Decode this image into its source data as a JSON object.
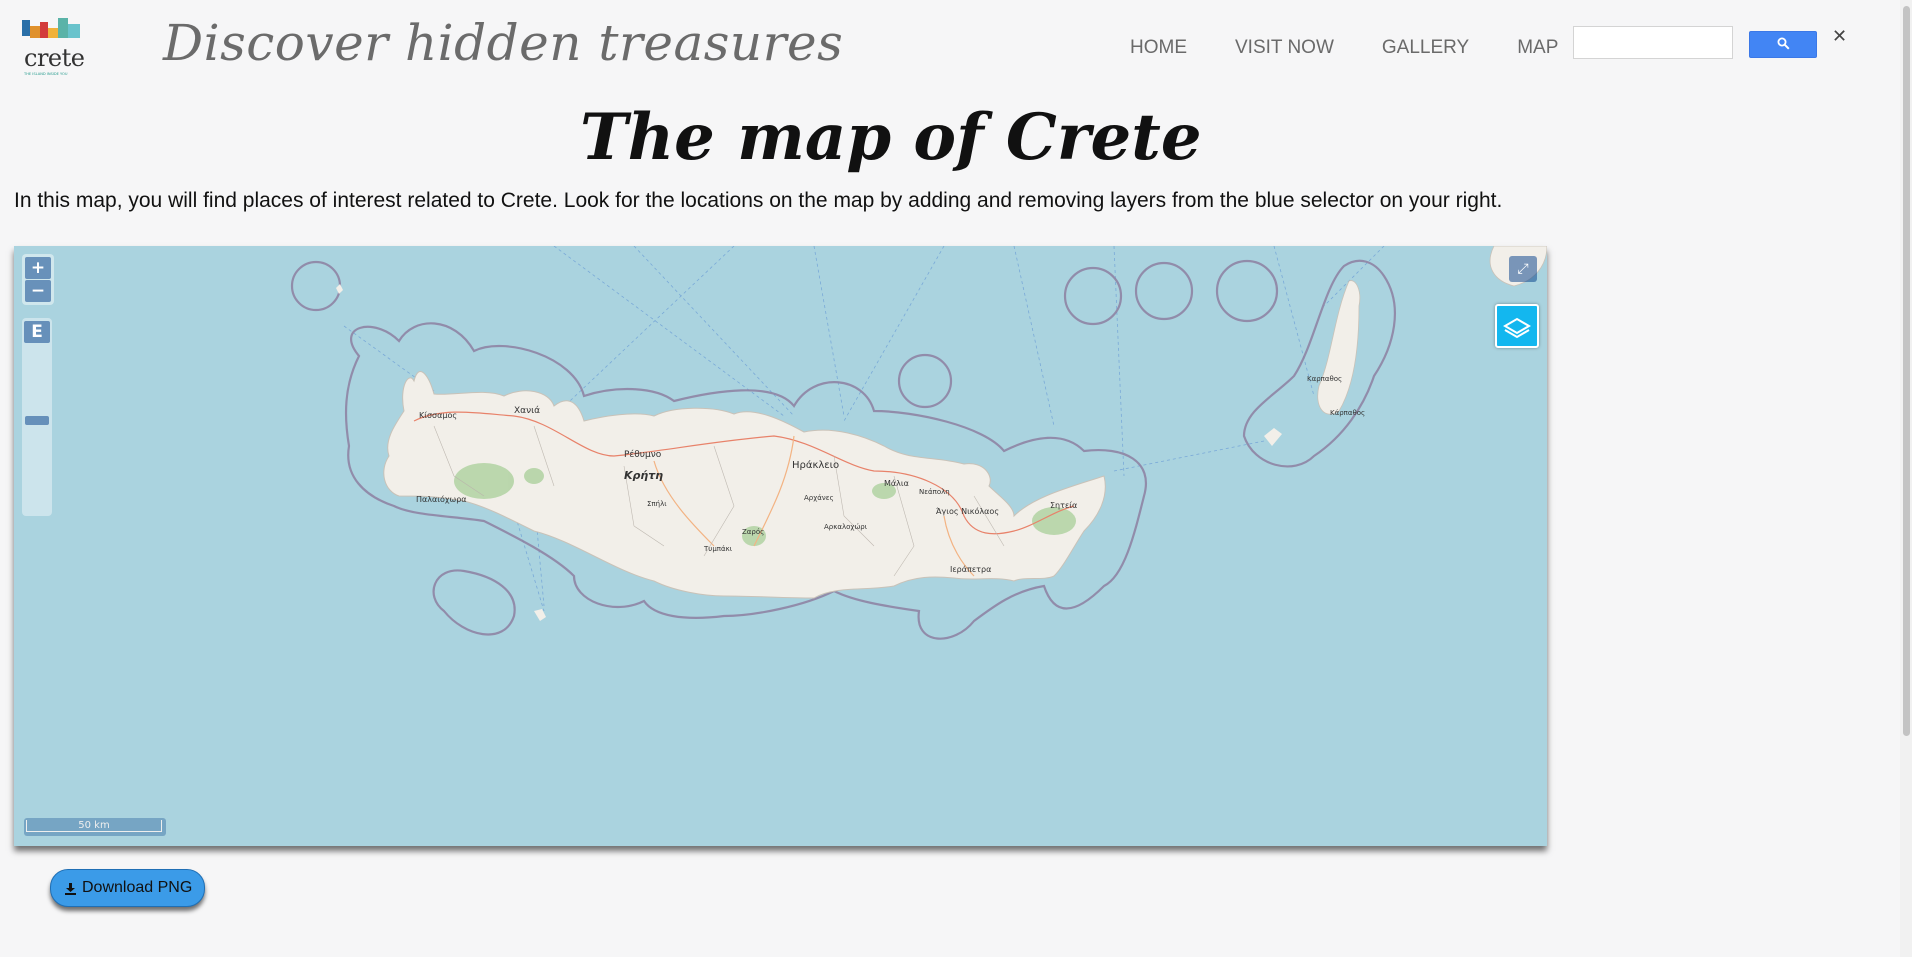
{
  "header": {
    "logo_text": "crete",
    "logo_subtext": "THE ISLAND INSIDE YOU",
    "tagline": "Discover hidden treasures"
  },
  "nav": [
    {
      "label": "HOME"
    },
    {
      "label": "VISIT NOW"
    },
    {
      "label": "GALLERY"
    },
    {
      "label": "MAP"
    }
  ],
  "search": {
    "placeholder": "",
    "button_icon": "search-icon",
    "clear_label": "✕"
  },
  "main": {
    "title": "The map of Crete",
    "intro": "In this map, you will find places of interest related to Crete. Look for the locations on the map by adding and removing layers from the blue selector on your right."
  },
  "map": {
    "zoom_in": "+",
    "zoom_out": "−",
    "extent_label": "E",
    "fullscreen_label": "⤢",
    "zoom_level_fraction": 0.55,
    "scale_label": "50 km",
    "colors": {
      "sea": "#aad3df",
      "land": "#f2efe9",
      "border": "#8d7fa1"
    },
    "place_labels": [
      {
        "text": "Κρήτη"
      },
      {
        "text": "Χανιά"
      },
      {
        "text": "Κίσσαμος"
      },
      {
        "text": "Ρέθυμνο"
      },
      {
        "text": "Ηράκλειο"
      },
      {
        "text": "Μάλια"
      },
      {
        "text": "Νεάπολη"
      },
      {
        "text": "Άγιος Νικόλαος"
      },
      {
        "text": "Σητεία"
      },
      {
        "text": "Ιεράπετρα"
      },
      {
        "text": "Αρχάνες"
      },
      {
        "text": "Αρκαλοχώρι"
      },
      {
        "text": "Ζαρός"
      },
      {
        "text": "Τυμπάκι"
      },
      {
        "text": "Σπήλι"
      },
      {
        "text": "Παλαιόχωρα"
      },
      {
        "text": "Καρπαθος"
      },
      {
        "text": "Κάρπαθος"
      }
    ]
  },
  "actions": {
    "download_label": "Download PNG",
    "download_icon": "download-icon"
  }
}
